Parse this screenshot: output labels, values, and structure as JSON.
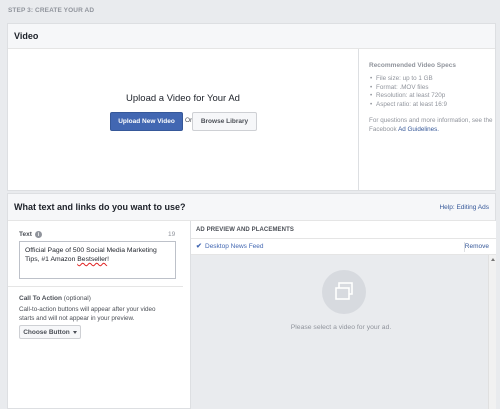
{
  "step_label": "STEP 3: CREATE YOUR AD",
  "video_section": {
    "title": "Video",
    "upload_title": "Upload a Video for Your Ad",
    "upload_button": "Upload New Video",
    "or_text": "Or",
    "browse_button": "Browse Library",
    "specs_title": "Recommended Video Specs",
    "specs": [
      "File size: up to 1 GB",
      "Format: .MOV files",
      "Resolution: at least 720p",
      "Aspect ratio: at least 16:9"
    ],
    "specs_note": "For questions and more information, see the Facebook",
    "specs_link": "Ad Guidelines."
  },
  "text_section": {
    "title": "What text and links do you want to use?",
    "help_link": "Help: Editing Ads",
    "text_label": "Text",
    "char_count": "19",
    "text_value_part1": "Official Page of 500 Social Media Marketing Tips, #1 Amazon ",
    "text_value_misspelled": "Bestseller",
    "text_value_part2": "!",
    "cta_label": "Call To Action",
    "cta_optional": "(optional)",
    "cta_desc": "Call-to-action buttons will appear after your video starts and will not appear in your preview.",
    "choose_button": "Choose Button"
  },
  "preview": {
    "title": "AD PREVIEW AND PLACEMENTS",
    "placement": "Desktop News Feed",
    "remove": "Remove",
    "placeholder": "Please select a video for your ad."
  },
  "colors": {
    "primary_button": "#4267b2",
    "link": "#365899",
    "page_bg": "#e9ebee"
  }
}
